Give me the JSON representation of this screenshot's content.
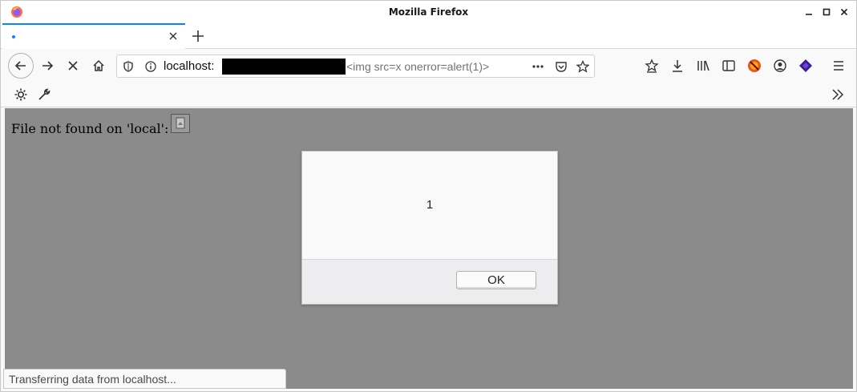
{
  "window": {
    "title": "Mozilla Firefox"
  },
  "tab": {
    "title": ""
  },
  "urlbar": {
    "host": "localhost:",
    "path": "<img src=x onerror=alert(1)>"
  },
  "page": {
    "not_found_text": "File not found on 'local':"
  },
  "dialog": {
    "message": "1",
    "ok_label": "OK"
  },
  "status": {
    "text": "Transferring data from localhost..."
  },
  "colors": {
    "accent": "#0a84ff",
    "content_bg": "#8b8b8b",
    "dialog_bg": "#f9f9fa"
  },
  "icons": [
    "firefox-logo-icon",
    "minimize-icon",
    "maximize-icon",
    "close-icon",
    "tab-close-icon",
    "new-tab-icon",
    "back-icon",
    "forward-icon",
    "stop-icon",
    "home-icon",
    "tracking-shield-icon",
    "site-info-icon",
    "page-actions-icon",
    "pocket-icon",
    "bookmark-star-icon",
    "bookmark-page-icon",
    "downloads-icon",
    "library-icon",
    "sidebar-icon",
    "extension-icon",
    "account-icon",
    "extension-stack-icon",
    "menu-icon",
    "settings-gear-icon",
    "wrench-icon",
    "overflow-chevron-icon",
    "broken-image-icon"
  ]
}
